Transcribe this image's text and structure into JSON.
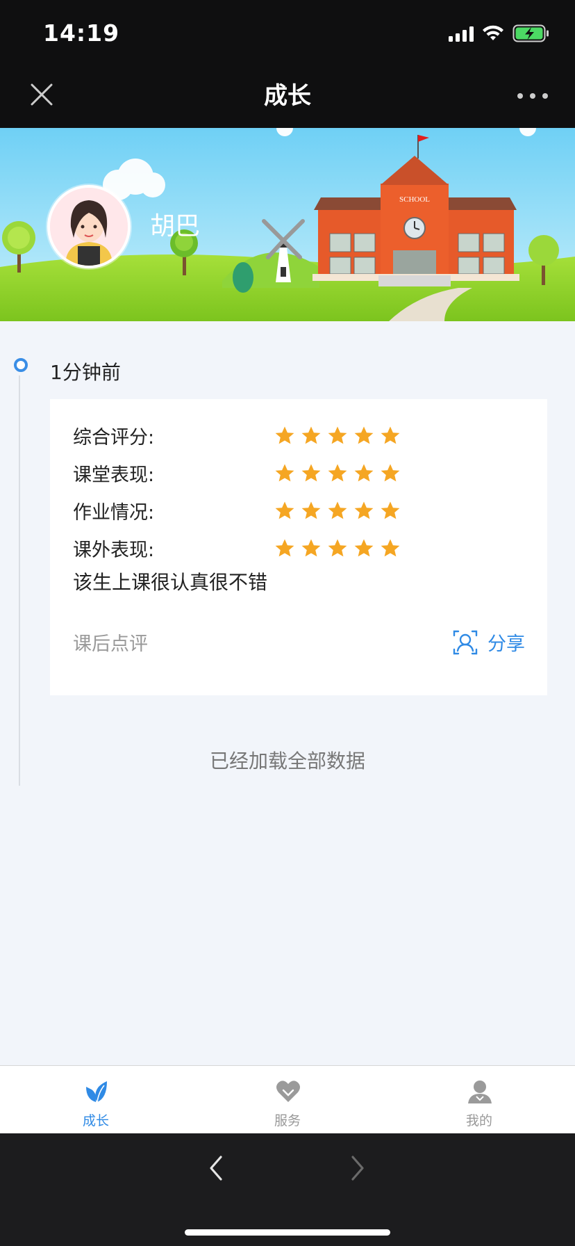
{
  "status_bar": {
    "time": "14:19"
  },
  "nav": {
    "title": "成长"
  },
  "profile": {
    "name": "胡巴"
  },
  "banner": {
    "school_sign": "SCHOOL"
  },
  "post": {
    "time_ago": "1分钟前",
    "ratings": [
      {
        "label": "综合评分:",
        "stars": 5
      },
      {
        "label": "课堂表现:",
        "stars": 5
      },
      {
        "label": "作业情况:",
        "stars": 5
      },
      {
        "label": "课外表现:",
        "stars": 5
      }
    ],
    "comment": "该生上课很认真很不错",
    "comment_type": "课后点评",
    "share_label": "分享"
  },
  "list_footer": "已经加载全部数据",
  "tabs": [
    {
      "label": "成长",
      "icon": "leaf-icon",
      "active": true
    },
    {
      "label": "服务",
      "icon": "heart-icon",
      "active": false
    },
    {
      "label": "我的",
      "icon": "person-icon",
      "active": false
    }
  ],
  "colors": {
    "accent": "#2f8ae5",
    "star": "#f5a623",
    "inactive": "#999999"
  }
}
